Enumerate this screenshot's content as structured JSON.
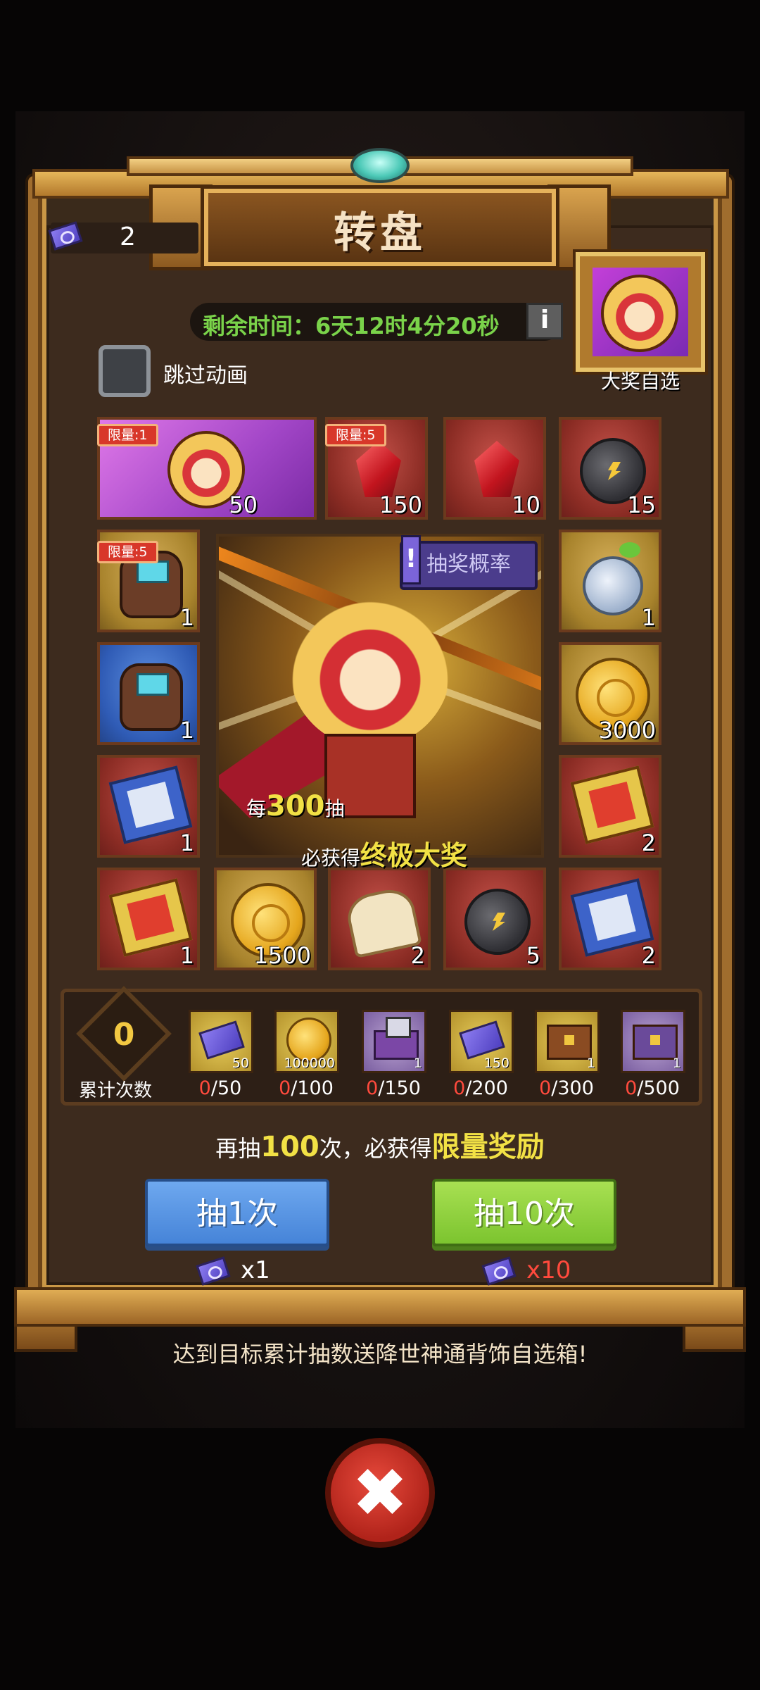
{
  "header": {
    "title": "转盘",
    "ticket_count": "2",
    "timer": "剩余时间：6天12时4分20秒",
    "info_icon": "i",
    "prize_select_label": "大奖自选",
    "skip_animation_label": "跳过动画"
  },
  "grid": {
    "c1": {
      "qty": "50",
      "limit": "限量:1",
      "icon": "monkey-king-icon"
    },
    "c2": {
      "qty": "150",
      "limit": "限量:5",
      "icon": "red-crystal-icon"
    },
    "c3": {
      "qty": "10",
      "icon": "red-crystal-icon"
    },
    "c4": {
      "qty": "15",
      "icon": "ore-icon"
    },
    "l1": {
      "qty": "1",
      "limit": "限量:5",
      "icon": "backpack-icon"
    },
    "l2": {
      "qty": "1",
      "icon": "backpack-icon"
    },
    "l3": {
      "qty": "1",
      "icon": "card-pack-icon"
    },
    "r1": {
      "qty": "1",
      "icon": "seed-icon"
    },
    "r2": {
      "qty": "3000",
      "icon": "gold-coin-icon"
    },
    "r3": {
      "qty": "2",
      "icon": "red-card-pack-icon"
    },
    "b1": {
      "qty": "1",
      "icon": "red-card-pack-icon"
    },
    "b2": {
      "qty": "1500",
      "icon": "gold-coin-icon"
    },
    "b3": {
      "qty": "2",
      "icon": "bread-icon"
    },
    "b4": {
      "qty": "5",
      "icon": "ore-icon"
    },
    "b5": {
      "qty": "2",
      "icon": "card-pack-icon"
    }
  },
  "center": {
    "probability_label": "抽奖概率",
    "probability_bang": "!",
    "every_prefix": "每",
    "every_number": "300",
    "every_suffix": "抽",
    "guarantee_prefix": "必获得",
    "guarantee_prize": "终极大奖"
  },
  "milestones": {
    "counter_value": "0",
    "counter_label": "累计次数",
    "items": [
      {
        "qty": "50",
        "current": "0",
        "target": "/50"
      },
      {
        "qty": "100000",
        "current": "0",
        "target": "/100"
      },
      {
        "qty": "1",
        "current": "0",
        "target": "/150"
      },
      {
        "qty": "150",
        "current": "0",
        "target": "/200"
      },
      {
        "qty": "1",
        "current": "0",
        "target": "/300"
      },
      {
        "qty": "1",
        "current": "0",
        "target": "/500"
      }
    ]
  },
  "remain": {
    "prefix": "再抽",
    "count": "100",
    "middle": "次，必获得",
    "reward": "限量奖励"
  },
  "buttons": {
    "draw_one": "抽1次",
    "draw_ten": "抽10次",
    "cost_one": "x1",
    "cost_ten": "x10"
  },
  "footer_note": "达到目标累计抽数送降世神通背饰自选箱!",
  "close_symbol": "✖",
  "colors": {
    "timer_green": "#7ad34a",
    "highlight_yellow": "#f2e145",
    "cost_red": "#ff4a3d",
    "draw_one_blue": "#5a97e4",
    "draw_ten_green": "#8fd13d"
  }
}
